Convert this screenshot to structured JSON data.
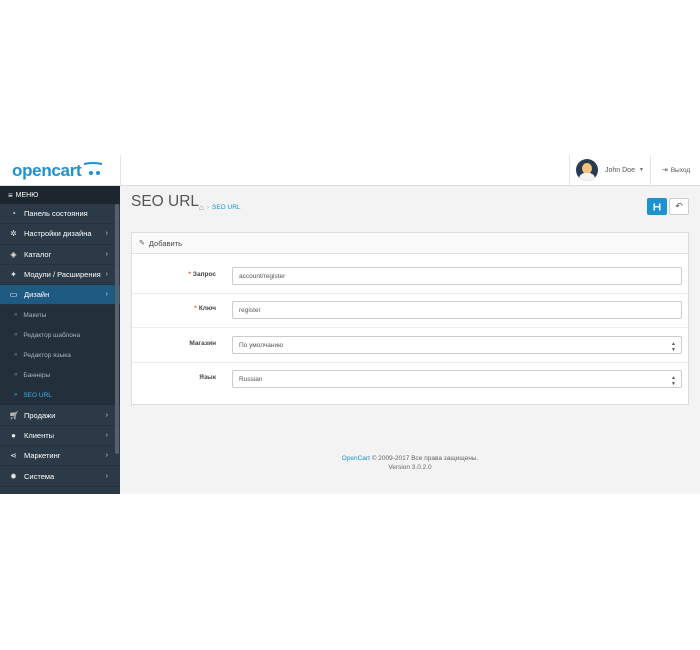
{
  "header": {
    "logo_text": "opencart",
    "user_name": "John Doe",
    "logout_label": "Выход"
  },
  "sidebar": {
    "menu_label": "МЕНЮ",
    "items": [
      {
        "label": "Панель состояния",
        "icon": "dashboard-icon",
        "has_children": false
      },
      {
        "label": "Настройки дизайна",
        "icon": "cogs-icon",
        "has_children": true
      },
      {
        "label": "Каталог",
        "icon": "tags-icon",
        "has_children": true
      },
      {
        "label": "Модули / Расширения",
        "icon": "puzzle-icon",
        "has_children": true
      },
      {
        "label": "Дизайн",
        "icon": "monitor-icon",
        "has_children": true,
        "active": true
      },
      {
        "label": "Продажи",
        "icon": "cart-icon",
        "has_children": true
      },
      {
        "label": "Клиенты",
        "icon": "user-icon",
        "has_children": true
      },
      {
        "label": "Маркетинг",
        "icon": "share-icon",
        "has_children": true
      },
      {
        "label": "Система",
        "icon": "gear-icon",
        "has_children": true
      }
    ],
    "design_sub": [
      {
        "label": "Макеты"
      },
      {
        "label": "Редактор шаблона"
      },
      {
        "label": "Редактор языка"
      },
      {
        "label": "Баннеры"
      },
      {
        "label": "SEO URL",
        "active": true
      }
    ]
  },
  "page": {
    "title": "SEO URL",
    "breadcrumb": "SEO URL"
  },
  "panel": {
    "heading": "Добавить",
    "fields": {
      "query_label": "Запрос",
      "query_value": "account/register",
      "keyword_label": "Ключ",
      "keyword_value": "register",
      "store_label": "Магазин",
      "store_value": "По умолчанию",
      "language_label": "Язык",
      "language_value": "Russian"
    }
  },
  "footer": {
    "link": "OpenCart",
    "copyright": "© 2009-2017 Все права защищены.",
    "version": "Version 3.0.2.0"
  },
  "colors": {
    "brand": "#1e91cf",
    "sidebar_bg": "#2c3a47",
    "sidebar_active": "#1f5a82",
    "required": "#e3503e"
  }
}
